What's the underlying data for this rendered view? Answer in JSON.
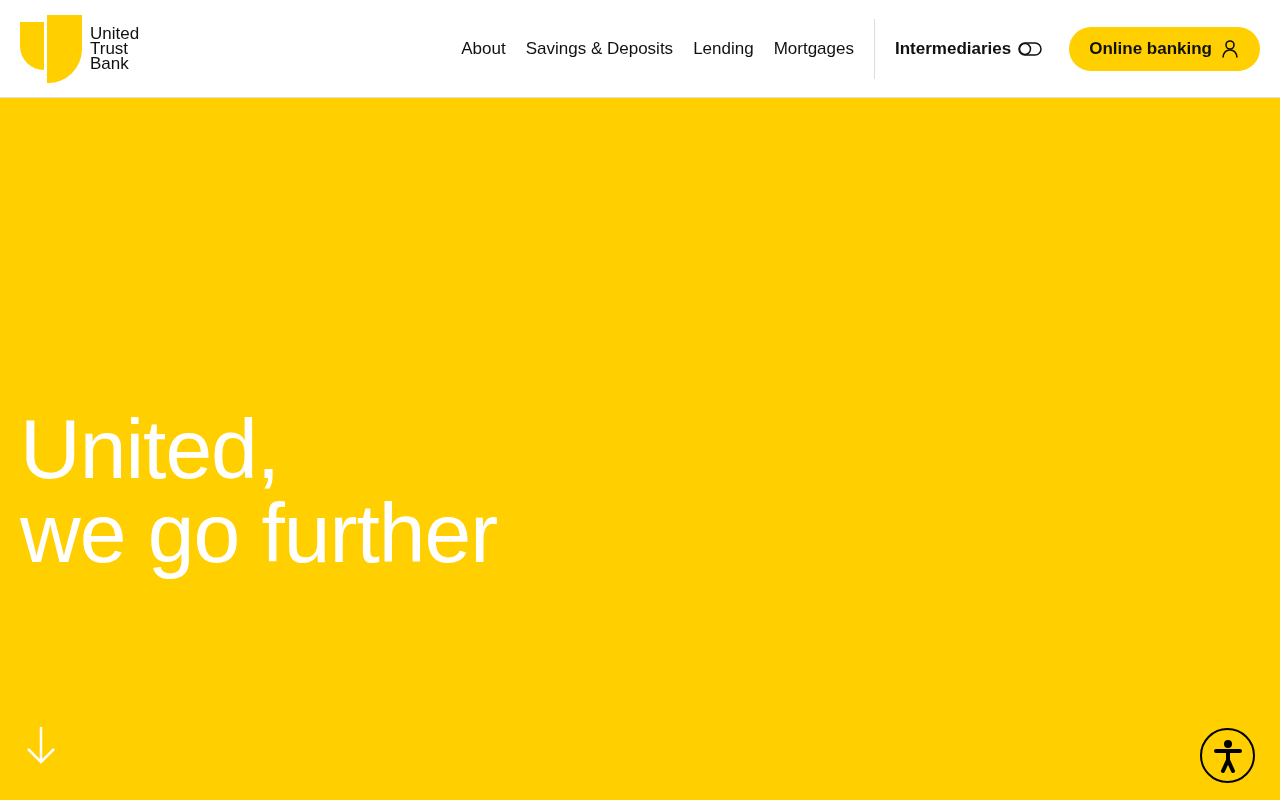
{
  "logo": {
    "lines": [
      "United",
      "Trust",
      "Bank"
    ]
  },
  "nav": {
    "links": [
      {
        "label": "About"
      },
      {
        "label": "Savings & Deposits"
      },
      {
        "label": "Lending"
      },
      {
        "label": "Mortgages"
      }
    ],
    "switch_link": {
      "label": "Intermediaries"
    },
    "cta": {
      "label": "Online banking"
    }
  },
  "hero": {
    "headline": [
      "United,",
      "we go further"
    ]
  }
}
